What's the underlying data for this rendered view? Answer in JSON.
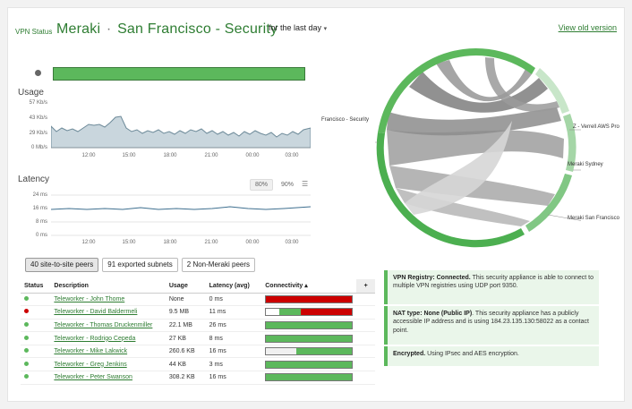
{
  "header": {
    "prefix": "VPN Status",
    "title_main": "Meraki",
    "title_sub": "San Francisco",
    "title_sep": "-",
    "title_last": "Security",
    "range": "for the last day",
    "old_version": "View old version"
  },
  "colors": {
    "accent": "#2e7d32",
    "green": "#5cb85c",
    "red": "#cc0000",
    "light_green": "#a5d6a7"
  },
  "usage": {
    "label": "Usage",
    "yticks": [
      "57 Kb/s",
      "43 Kb/s",
      "29 Kb/s",
      "0 Mb/s"
    ],
    "xticks": [
      "12:00",
      "15:00",
      "18:00",
      "21:00",
      "00:00",
      "03:00"
    ]
  },
  "latency": {
    "label": "Latency",
    "yticks": [
      "24 ms",
      "16 ms",
      "8 ms",
      "0 ms"
    ],
    "xticks": [
      "12:00",
      "15:00",
      "18:00",
      "21:00",
      "00:00",
      "03:00"
    ],
    "buttons": [
      "80%",
      "90%"
    ],
    "menu_icon": "hamburger-icon"
  },
  "tabs": [
    "40 site-to-site peers",
    "91 exported subnets",
    "2 Non-Meraki peers"
  ],
  "table": {
    "headers": [
      "Status",
      "Description",
      "Usage",
      "Latency (avg)",
      "Connectivity ▴",
      "+"
    ],
    "rows": [
      {
        "status": "#5cb85c",
        "desc": "Teleworker - John Thome",
        "usage": "None",
        "latency": "0 ms",
        "conn": [
          [
            "#cc0000",
            100
          ]
        ]
      },
      {
        "status": "#cc0000",
        "desc": "Teleworker - David Baldermeli",
        "usage": "9.5 MB",
        "latency": "11 ms",
        "conn": [
          [
            "#ffffff",
            15
          ],
          [
            "#5cb85c",
            25
          ],
          [
            "#cc0000",
            60
          ]
        ]
      },
      {
        "status": "#5cb85c",
        "desc": "Teleworker - Thomas Druckenmiller",
        "usage": "22.1 MB",
        "latency": "26 ms",
        "conn": [
          [
            "#5cb85c",
            100
          ]
        ]
      },
      {
        "status": "#5cb85c",
        "desc": "Teleworker - Rodrigo Cepeda",
        "usage": "27 KB",
        "latency": "8 ms",
        "conn": [
          [
            "#5cb85c",
            100
          ]
        ]
      },
      {
        "status": "#5cb85c",
        "desc": "Teleworker - Mike Lakwick",
        "usage": "260.6 KB",
        "latency": "16 ms",
        "conn": [
          [
            "#f0f0f0",
            35
          ],
          [
            "#5cb85c",
            65
          ]
        ]
      },
      {
        "status": "#5cb85c",
        "desc": "Teleworker - Greg Jenkins",
        "usage": "44 KB",
        "latency": "3 ms",
        "conn": [
          [
            "#5cb85c",
            100
          ]
        ]
      },
      {
        "status": "#5cb85c",
        "desc": "Teleworker - Peter Swanson",
        "usage": "308.2 KB",
        "latency": "16 ms",
        "conn": [
          [
            "#5cb85c",
            100
          ]
        ]
      }
    ]
  },
  "panels": [
    {
      "bold": "VPN Registry: Connected.",
      "text": " This security appliance is able to connect to multiple VPN registries using UDP port 9350."
    },
    {
      "bold": "NAT type: None (Public IP)",
      "text": ". This security appliance has a publicly accessible IP address and is using 184.23.135.130:58022 as a contact point."
    },
    {
      "bold": "Encrypted.",
      "text": " Using IPsec and AES encryption."
    }
  ],
  "chord": {
    "labels": [
      "Francisco - Security",
      "Z - Verrell AWS Pro",
      "Meraki Sydney",
      "Meraki San Francisco"
    ]
  }
}
